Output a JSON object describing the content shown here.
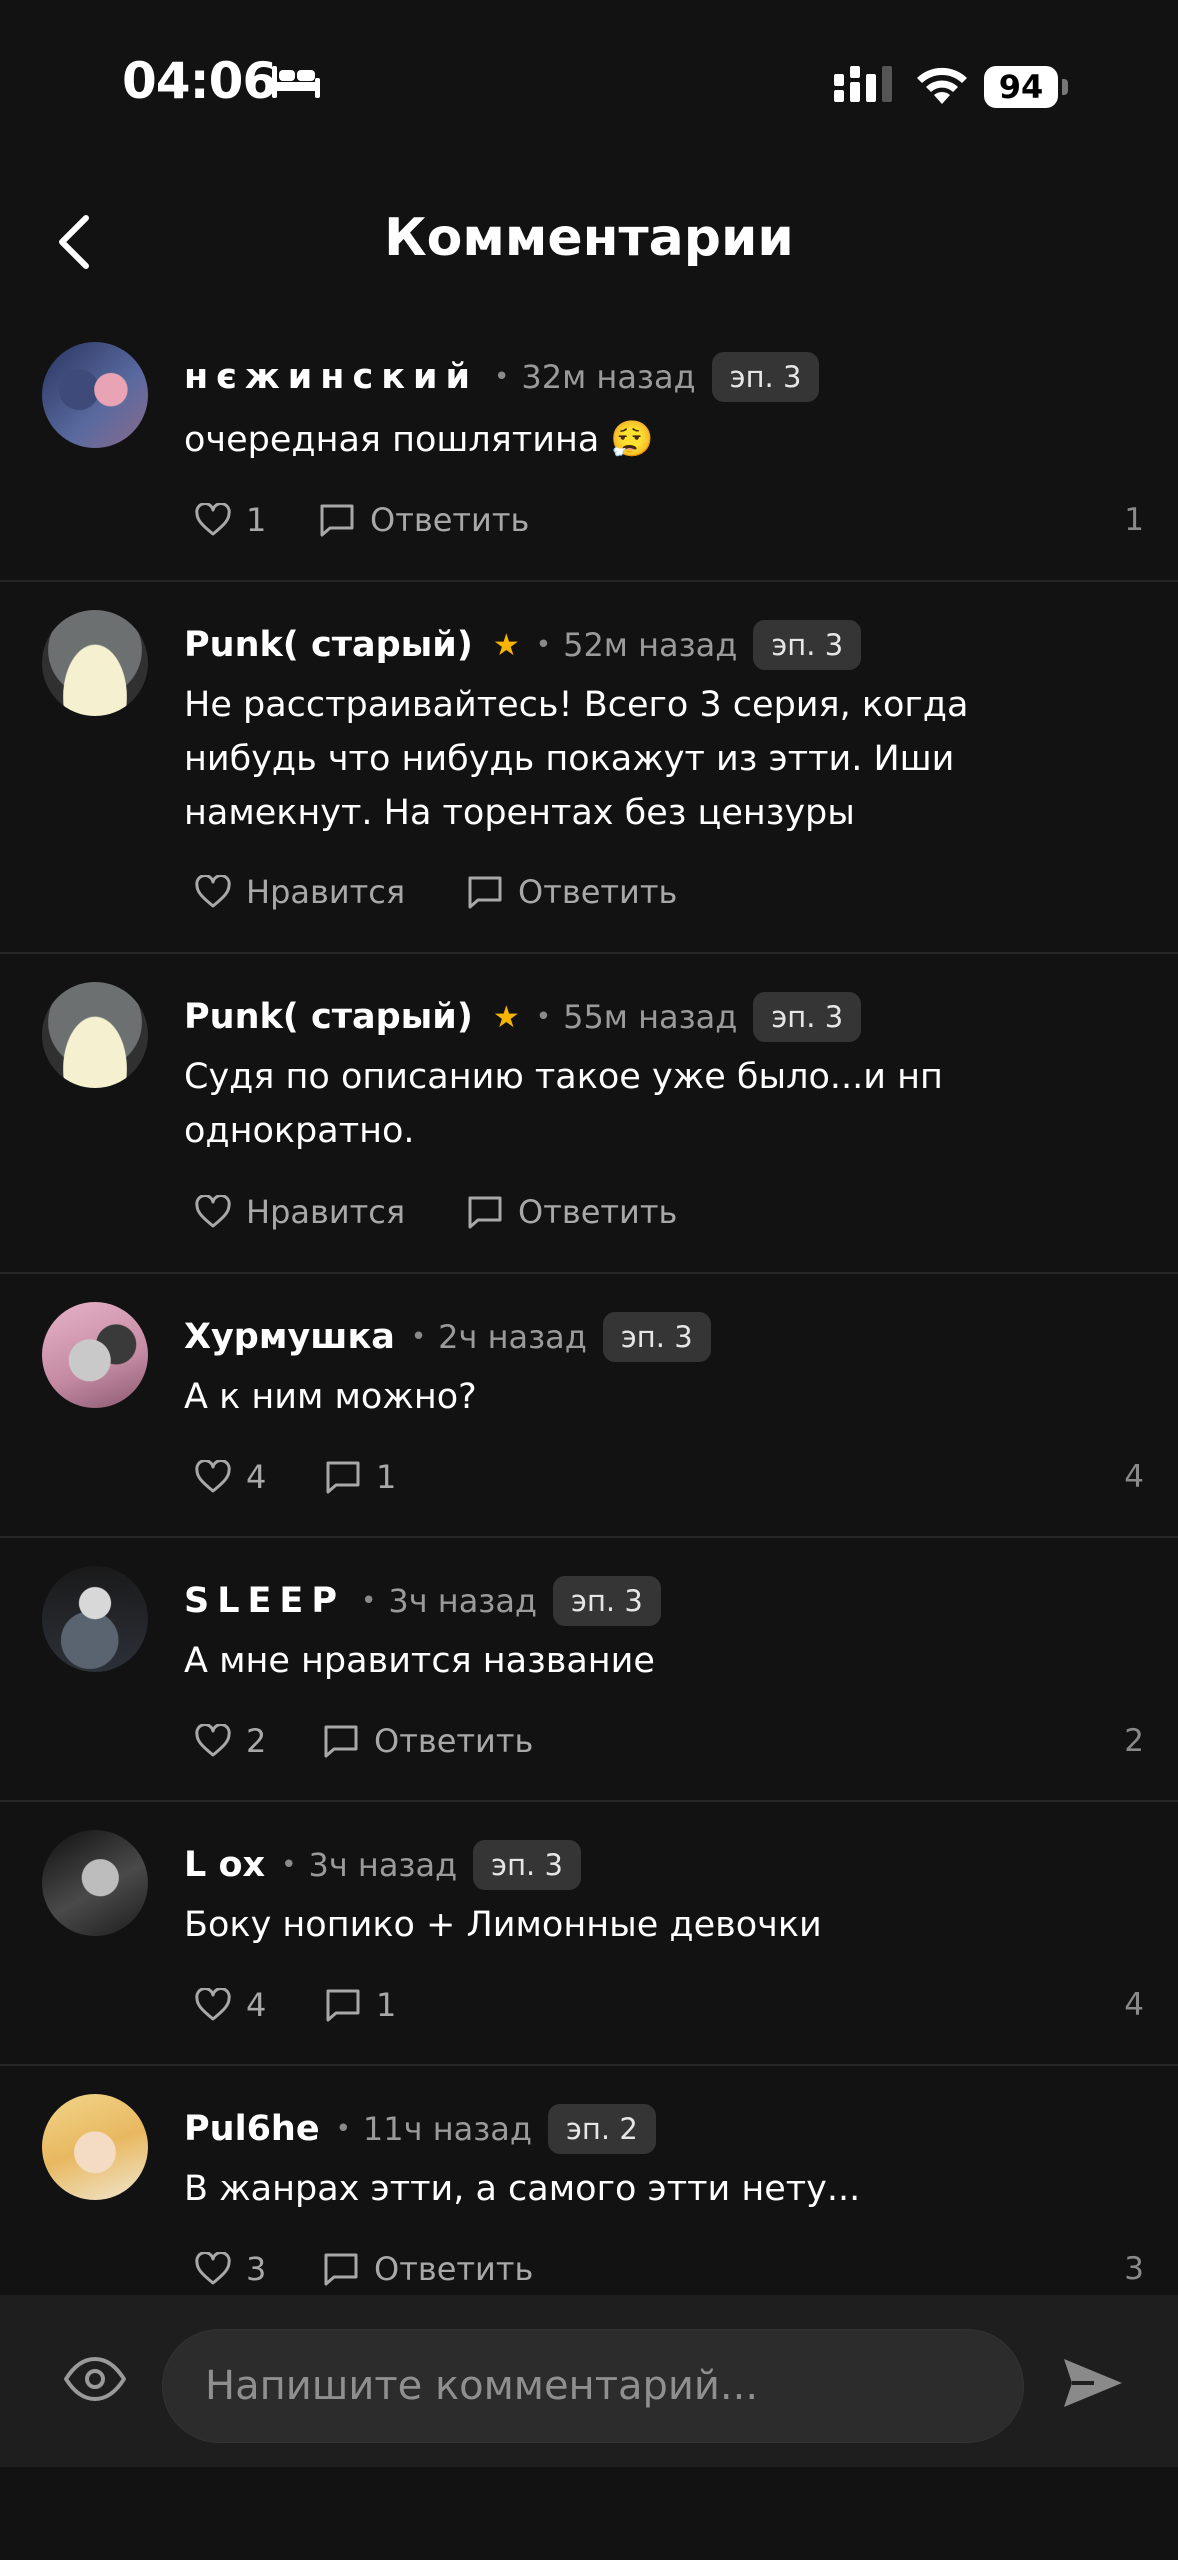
{
  "status_bar": {
    "time": "04:06",
    "battery": "94",
    "icons": [
      "bed-icon",
      "signal-icon",
      "wifi-icon",
      "battery-icon"
    ]
  },
  "header": {
    "title": "Комментарии",
    "back_icon": "chevron-left-icon"
  },
  "comments": [
    {
      "author": "нєжинский",
      "star": false,
      "ago": "32м назад",
      "episode": "эп. 3",
      "text": "очередная пошлятина 😮‍💨",
      "likes": "1",
      "reply_label": "Ответить",
      "reply_count": "",
      "count": "1"
    },
    {
      "author": "Punk( старый)",
      "star": true,
      "ago": "52м назад",
      "episode": "эп. 3",
      "text": "Не расстраивайтесь! Всего 3 серия, когда нибудь что нибудь покажут из этти. Иши намекнут. На торентах без цензуры",
      "likes": "Нравится",
      "reply_label": "Ответить",
      "reply_count": "",
      "count": ""
    },
    {
      "author": "Punk( старый)",
      "star": true,
      "ago": "55м назад",
      "episode": "эп. 3",
      "text": "Судя по описанию такое уже было...и нп однократно.",
      "likes": "Нравится",
      "reply_label": "Ответить",
      "reply_count": "",
      "count": ""
    },
    {
      "author": "Хурмушка",
      "star": false,
      "ago": "2ч назад",
      "episode": "эп. 3",
      "text": "А к ним можно?",
      "likes": "4",
      "reply_label": "",
      "reply_count": "1",
      "count": "4"
    },
    {
      "author": "SLEEP",
      "star": false,
      "ago": "3ч назад",
      "episode": "эп. 3",
      "text": "А мне нравится название",
      "likes": "2",
      "reply_label": "Ответить",
      "reply_count": "",
      "count": "2"
    },
    {
      "author": "L ox",
      "star": false,
      "ago": "3ч назад",
      "episode": "эп. 3",
      "text": "Боку нопико + Лимонные девочки",
      "likes": "4",
      "reply_label": "",
      "reply_count": "1",
      "count": "4"
    },
    {
      "author": "Pul6he",
      "star": false,
      "ago": "11ч назад",
      "episode": "эп. 2",
      "text": "В жанрах этти, а самого этти нету...",
      "likes": "3",
      "reply_label": "Ответить",
      "reply_count": "",
      "count": "3"
    }
  ],
  "separator": "•",
  "star_symbol": "★",
  "composer": {
    "placeholder": "Напишите комментарий...",
    "eye_icon": "eye-icon",
    "send_icon": "send-icon"
  },
  "colors": {
    "background": "#121212",
    "star": "#f5b400",
    "badge": "#353535",
    "muted": "#9a9a9a"
  }
}
